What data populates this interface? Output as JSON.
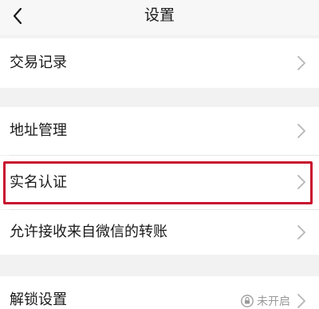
{
  "header": {
    "title": "设置",
    "back_icon": "chevron-left-icon"
  },
  "settings": {
    "transaction_records": "交易记录",
    "address_management": "地址管理",
    "real_name_verification": "实名认证",
    "allow_wechat_transfer": "允许接收来自微信的转账",
    "unlock_settings": "解锁设置",
    "unlock_status": "未开启"
  },
  "icons": {
    "row_chevron": "chevron-right-icon",
    "status_icon": "lock-icon"
  },
  "colors": {
    "background": "#f2f2f2",
    "cell_background": "#ffffff",
    "highlight_border": "#c8102e",
    "chevron": "#b5b5b5",
    "status_text": "#9a9a9a"
  }
}
